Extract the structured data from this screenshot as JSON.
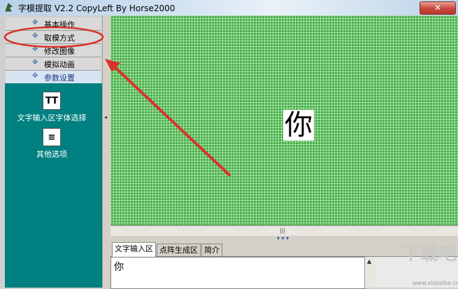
{
  "titlebar": {
    "title": "字模提取 V2.2   CopyLeft By Horse2000",
    "close_label": "✕"
  },
  "menu": {
    "bullet": "✥",
    "items": [
      {
        "label": "基本操作"
      },
      {
        "label": "取模方式"
      },
      {
        "label": "修改图像"
      },
      {
        "label": "模拟动画"
      },
      {
        "label": "参数设置"
      }
    ]
  },
  "tools": [
    {
      "label": "文字输入区字体选择",
      "icon_glyph": "TT",
      "icon": "font-icon"
    },
    {
      "label": "其他选项",
      "icon_glyph": "≡",
      "icon": "document-icon"
    }
  ],
  "canvas": {
    "glyph": "你"
  },
  "tabs": [
    {
      "label": "文字输入区"
    },
    {
      "label": "点阵生成区"
    },
    {
      "label": "简介"
    }
  ],
  "input_area": {
    "text": "你"
  },
  "watermark": {
    "text": "下载吧",
    "small": "www.xiazaiba.com"
  },
  "colors": {
    "accent": "#008080",
    "grid": "#49b04a",
    "annotation": "#d9342b"
  }
}
